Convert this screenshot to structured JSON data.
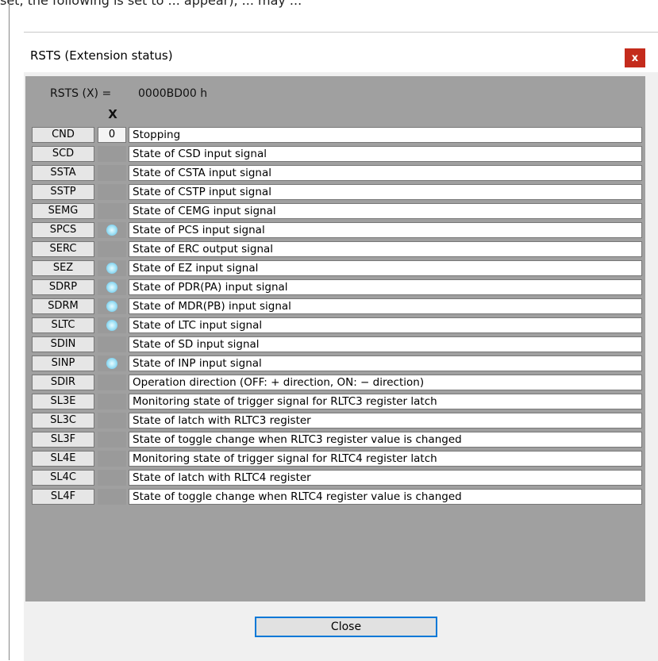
{
  "background_fragment": "set, the following is set to ... appear), ... may ...",
  "dialog": {
    "title": "RSTS (Extension status)",
    "close_x_label": "x",
    "header_label": "RSTS (X) =",
    "header_value": "0000BD00 h",
    "column_header": "X",
    "close_button_label": "Close",
    "led_color": "#8fd9f2",
    "close_x_color": "#c42b1c"
  },
  "rows": [
    {
      "name": "CND",
      "state": "value",
      "value": "0",
      "desc": "Stopping"
    },
    {
      "name": "SCD",
      "state": "off",
      "desc": "State of CSD input signal"
    },
    {
      "name": "SSTA",
      "state": "off",
      "desc": "State of CSTA input signal"
    },
    {
      "name": "SSTP",
      "state": "off",
      "desc": "State of CSTP input signal"
    },
    {
      "name": "SEMG",
      "state": "off",
      "desc": "State of CEMG input signal"
    },
    {
      "name": "SPCS",
      "state": "on",
      "desc": "State of PCS input signal"
    },
    {
      "name": "SERC",
      "state": "off",
      "desc": "State of ERC output signal"
    },
    {
      "name": "SEZ",
      "state": "on",
      "desc": "State of EZ input signal"
    },
    {
      "name": "SDRP",
      "state": "on",
      "desc": "State of PDR(PA) input signal"
    },
    {
      "name": "SDRM",
      "state": "on",
      "desc": "State of MDR(PB) input signal"
    },
    {
      "name": "SLTC",
      "state": "on",
      "desc": "State of LTC input signal"
    },
    {
      "name": "SDIN",
      "state": "off",
      "desc": "State of SD input signal"
    },
    {
      "name": "SINP",
      "state": "on",
      "desc": "State of INP input signal"
    },
    {
      "name": "SDIR",
      "state": "off",
      "desc": "Operation direction (OFF: + direction, ON: − direction)"
    },
    {
      "name": "SL3E",
      "state": "off",
      "desc": "Monitoring state of trigger signal for RLTC3 register latch"
    },
    {
      "name": "SL3C",
      "state": "off",
      "desc": "State of latch with RLTC3 register"
    },
    {
      "name": "SL3F",
      "state": "off",
      "desc": "State of toggle change when RLTC3 register value is changed"
    },
    {
      "name": "SL4E",
      "state": "off",
      "desc": "Monitoring state of trigger signal for RLTC4 register latch"
    },
    {
      "name": "SL4C",
      "state": "off",
      "desc": "State of latch with RLTC4 register"
    },
    {
      "name": "SL4F",
      "state": "off",
      "desc": "State of toggle change when RLTC4 register value is changed"
    }
  ]
}
